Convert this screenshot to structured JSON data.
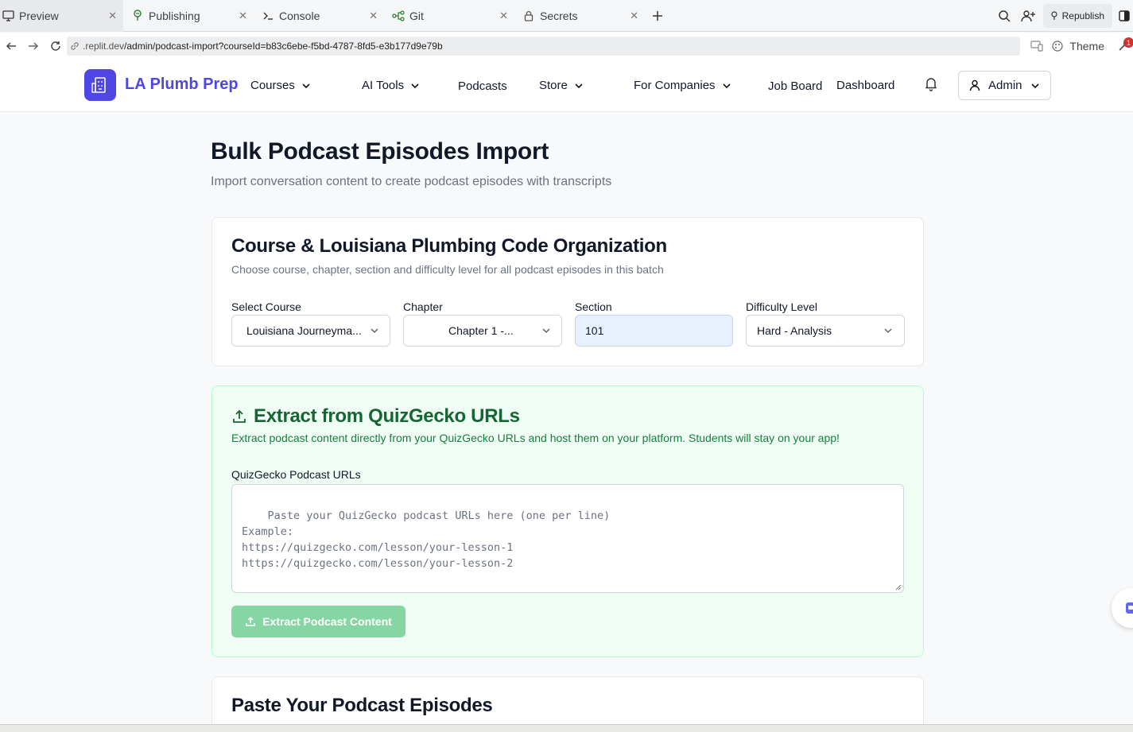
{
  "browser": {
    "tabs": [
      {
        "label": "Preview",
        "icon": "monitor-icon"
      },
      {
        "label": "Publishing",
        "icon": "publishing-icon"
      },
      {
        "label": "Console",
        "icon": "terminal-icon"
      },
      {
        "label": "Git",
        "icon": "git-icon"
      },
      {
        "label": "Secrets",
        "icon": "lock-icon"
      }
    ],
    "republish_label": "Republish",
    "url_domain": ".replit.dev",
    "url_path": "/admin/podcast-import?courseId=b83c6ebe-f5bd-4787-8fd5-e3b177d9e79b",
    "theme_label": "Theme",
    "notification_count": "1"
  },
  "header": {
    "brand": "LA Plumb Prep",
    "nav": {
      "courses": "Courses",
      "ai_tools": "AI Tools",
      "podcasts": "Podcasts",
      "store": "Store",
      "for_companies": "For Companies",
      "job_board": "Job Board",
      "dashboard": "Dashboard"
    },
    "admin_label": "Admin",
    "accent_color": "#4f46e5"
  },
  "page": {
    "title": "Bulk Podcast Episodes Import",
    "subtitle": "Import conversation content to create podcast episodes with transcripts"
  },
  "organization": {
    "title": "Course & Louisiana Plumbing Code Organization",
    "description": "Choose course, chapter, section and difficulty level for all podcast episodes in this batch",
    "course_label": "Select Course",
    "course_value": "Louisiana Journeyma...",
    "chapter_label": "Chapter",
    "chapter_value": "Chapter 1 -...",
    "section_label": "Section",
    "section_value": "101",
    "difficulty_label": "Difficulty Level",
    "difficulty_value": "Hard - Analysis"
  },
  "extract": {
    "title": "Extract from QuizGecko URLs",
    "description": "Extract podcast content directly from your QuizGecko URLs and host them on your platform. Students will stay on your app!",
    "urls_label": "QuizGecko Podcast URLs",
    "urls_placeholder": "Paste your QuizGecko podcast URLs here (one per line)\nExample:\nhttps://quizgecko.com/lesson/your-lesson-1\nhttps://quizgecko.com/lesson/your-lesson-2",
    "button_label": "Extract Podcast Content",
    "color": "#166534"
  },
  "paste": {
    "title": "Paste Your Podcast Episodes"
  }
}
